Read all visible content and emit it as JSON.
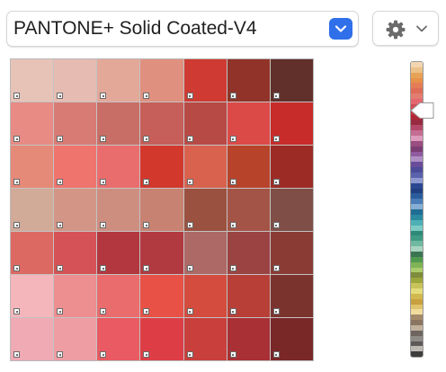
{
  "library": {
    "selected": "PANTONE+ Solid Coated-V4",
    "accent_color": "#2f6fea"
  },
  "toolbar": {
    "options_icon": "gear-icon",
    "options_chevron": "chevron-down-icon"
  },
  "swatches": {
    "rows": [
      [
        "#e7c3b7",
        "#e6bcb2",
        "#e3a898",
        "#e0907e",
        "#cf3b32",
        "#913328",
        "#62302a"
      ],
      [
        "#e78b84",
        "#d97b75",
        "#c96e66",
        "#c65f59",
        "#b84a46",
        "#dc4a48",
        "#c82c2a"
      ],
      [
        "#e58978",
        "#ef746d",
        "#ea6d6e",
        "#d3382d",
        "#d9624f",
        "#b8432b",
        "#9c2b26"
      ],
      [
        "#d1aa98",
        "#d39586",
        "#cd8e80",
        "#c88271",
        "#9b513f",
        "#a45446",
        "#7e4e47"
      ],
      [
        "#dc6a62",
        "#d55356",
        "#b3373e",
        "#b13a40",
        "#ad6965",
        "#9b4343",
        "#8a3c34"
      ],
      [
        "#f4b6bb",
        "#ed8e91",
        "#eb6c6c",
        "#e85246",
        "#d34c3d",
        "#b83f37",
        "#7b332e"
      ],
      [
        "#efaab3",
        "#ee9da3",
        "#e95a62",
        "#dd3e46",
        "#c83f3b",
        "#a93035",
        "#7a2728"
      ]
    ]
  },
  "hue_strip": {
    "bands": [
      "#f3d6b0",
      "#ecc089",
      "#e6a357",
      "#e8914a",
      "#e47d57",
      "#de6c59",
      "#e37d71",
      "#e46770",
      "#d04e56",
      "#c2313c",
      "#b12735",
      "#972a40",
      "#b3486a",
      "#c46c91",
      "#dd9bbd",
      "#9a4d80",
      "#7b3e74",
      "#8f5a9f",
      "#b08fc4",
      "#6a4d9a",
      "#4c4b9a",
      "#5b62ad",
      "#8e9ad0",
      "#2c4791",
      "#203f80",
      "#2b5c9c",
      "#4b7cb7",
      "#85aed2",
      "#1f6d95",
      "#2a8aa0",
      "#4eb0b5",
      "#7dcbc4",
      "#2d8978",
      "#3f9b84",
      "#6fb9a0",
      "#a9d4c0",
      "#3b7451",
      "#4f9a4f",
      "#7fb356",
      "#abcc6b",
      "#7e8c3c",
      "#9ca63c",
      "#c8c35a",
      "#e4dd7c",
      "#d1b94e",
      "#c8a03f",
      "#e0c36c",
      "#f0dc9d",
      "#a48a6b",
      "#8b7561",
      "#c1b29e",
      "#6e6560",
      "#8e8a86",
      "#5c5a58",
      "#bdbab4",
      "#3e3d3c"
    ]
  }
}
